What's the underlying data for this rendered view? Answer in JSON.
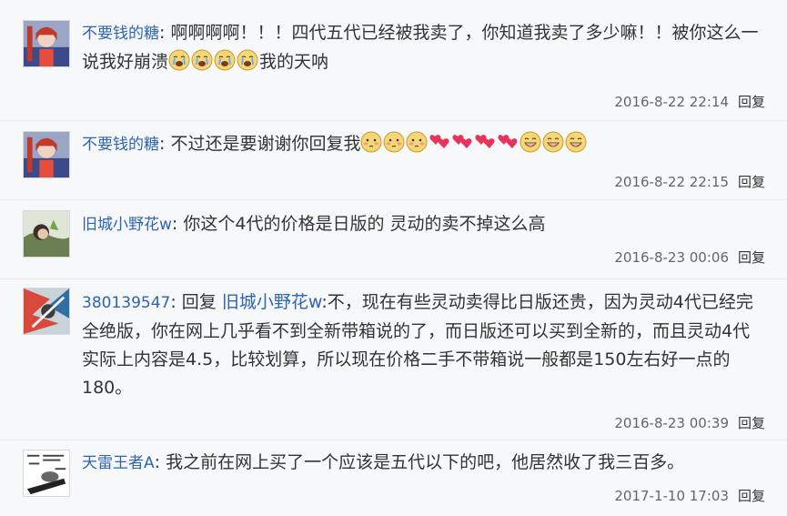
{
  "comments": [
    {
      "user": "不要钱的糖",
      "sep": ":",
      "text_a": "啊啊啊啊！！！四代五代已经被我卖了，你知道我卖了多少嘛！！被你这么一说我好崩溃",
      "text_b": "我的天呐",
      "time": "2016-8-22 22:14",
      "reply": "回复",
      "emoji": [
        "crying-icon",
        "crying-icon",
        "crying-icon",
        "crying-icon"
      ]
    },
    {
      "user": "不要钱的糖",
      "sep": ":",
      "text_a": "不过还是要谢谢你回复我",
      "time": "2016-8-22 22:15",
      "reply": "回复",
      "emoji": [
        "blush-icon",
        "blush-icon",
        "blush-icon",
        "hearts-icon",
        "hearts-icon",
        "hearts-icon",
        "hearts-icon",
        "grin-icon",
        "grin-icon",
        "grin-icon"
      ]
    },
    {
      "user": "旧城小野花w",
      "sep": ":",
      "text_a": "你这个4代的价格是日版的 灵动的卖不掉这么高",
      "time": "2016-8-23 00:06",
      "reply": "回复"
    },
    {
      "user": "380139547",
      "sep": ":",
      "reply_prefix": "回复",
      "reply_to": "旧城小野花w",
      "text_a": ":不，现在有些灵动卖得比日版还贵，因为灵动4代已经完全绝版，你在网上几乎看不到全新带箱说的了，而日版还可以买到全新的，而且灵动4代实际上内容是4.5，比较划算，所以现在价格二手不带箱说一般都是150左右好一点的180。",
      "time": "2016-8-23 00:39",
      "reply": "回复"
    },
    {
      "user": "天雷王者A",
      "sep": ":",
      "text_a": "我之前在网上买了一个应该是五代以下的吧，他居然收了我三百多。",
      "time": "2017-1-10 17:03",
      "reply": "回复"
    }
  ]
}
